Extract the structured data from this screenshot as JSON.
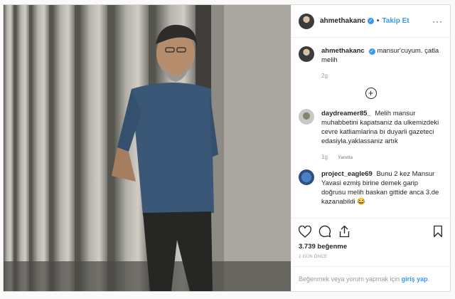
{
  "post": {
    "username": "ahmethakanc",
    "follow_label": "Takip Et",
    "more_label": "···",
    "caption_user": "ahmethakanc",
    "caption_text": "mansur'cuyum. çatla melih",
    "caption_time": "2g"
  },
  "comments": [
    {
      "user": "daydreamer85_",
      "text": "Melih mansur muhabbetini kapatsaniz da ulkemizdeki cevre katliamlarina bı duyarli gazeteci edasiyla.yaklassaniz artık",
      "time": "1g",
      "reply_label": "Yanıtla"
    },
    {
      "user": "project_eagle69",
      "text": "Bunu 2 kez Mansur Yavasi ezmiş birine demek garip doğrusu melih baskan gittide anca 3.de kazanabildi 😂",
      "time": "",
      "reply_label": ""
    }
  ],
  "stats": {
    "likes": "3.739 beğenme",
    "posted_ago": "2 GÜN ÖNCE"
  },
  "footer": {
    "prompt": "Beğenmek veya yorum yapmak için",
    "login_label": "giriş yap",
    "suffix": "."
  },
  "icons": {
    "verified": "verified-badge",
    "like": "heart-icon",
    "comment": "comment-icon",
    "share": "share-icon",
    "save": "bookmark-icon",
    "load_more": "plus-circle-icon"
  },
  "colors": {
    "accent": "#3897f0",
    "muted": "#999999"
  }
}
